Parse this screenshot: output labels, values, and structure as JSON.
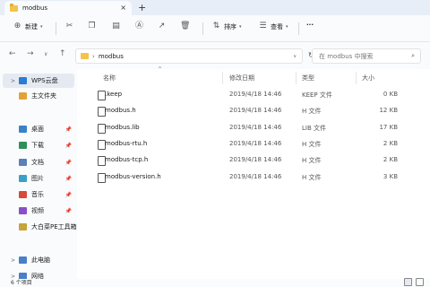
{
  "tab": {
    "title": "modbus",
    "close": "×",
    "new": "+"
  },
  "toolbar": {
    "new_label": "新建",
    "sort_label": "排序",
    "view_label": "查看",
    "more": "···"
  },
  "address": {
    "folder": "modbus",
    "search_placeholder": "在 modbus 中搜索"
  },
  "sidebar": {
    "items": [
      {
        "label": "WPS云盘",
        "chev": ">",
        "color": "#2b7cd3"
      },
      {
        "label": "主文件夹",
        "chev": "",
        "color": "#e0a33a"
      },
      {
        "label": "桌面",
        "chev": "",
        "color": "#3a82c8",
        "pin": true
      },
      {
        "label": "下载",
        "chev": "",
        "color": "#2f8f5a",
        "pin": true
      },
      {
        "label": "文档",
        "chev": "",
        "color": "#5b7fb8",
        "pin": true
      },
      {
        "label": "图片",
        "chev": "",
        "color": "#3aa0c8",
        "pin": true
      },
      {
        "label": "音乐",
        "chev": "",
        "color": "#d64a3a",
        "pin": true
      },
      {
        "label": "视频",
        "chev": "",
        "color": "#8a4fc8",
        "pin": true
      },
      {
        "label": "大白菜PE工具箱",
        "chev": "",
        "color": "#c8a23a",
        "pin": false
      },
      {
        "label": "此电脑",
        "chev": ">",
        "color": "#4a7fc8"
      },
      {
        "label": "网络",
        "chev": ">",
        "color": "#4a7fc8"
      }
    ]
  },
  "columns": {
    "name": "名称",
    "date": "修改日期",
    "type": "类型",
    "size": "大小"
  },
  "files": [
    {
      "name": ".keep",
      "date": "2019/4/18 14:46",
      "type": "KEEP 文件",
      "size": "0 KB"
    },
    {
      "name": "modbus.h",
      "date": "2019/4/18 14:46",
      "type": "H 文件",
      "size": "12 KB"
    },
    {
      "name": "modbus.lib",
      "date": "2019/4/18 14:46",
      "type": "LIB 文件",
      "size": "17 KB"
    },
    {
      "name": "modbus-rtu.h",
      "date": "2019/4/18 14:46",
      "type": "H 文件",
      "size": "2 KB"
    },
    {
      "name": "modbus-tcp.h",
      "date": "2019/4/18 14:46",
      "type": "H 文件",
      "size": "2 KB"
    },
    {
      "name": "modbus-version.h",
      "date": "2019/4/18 14:46",
      "type": "H 文件",
      "size": "3 KB"
    }
  ],
  "status": {
    "count": "6 个项目"
  }
}
